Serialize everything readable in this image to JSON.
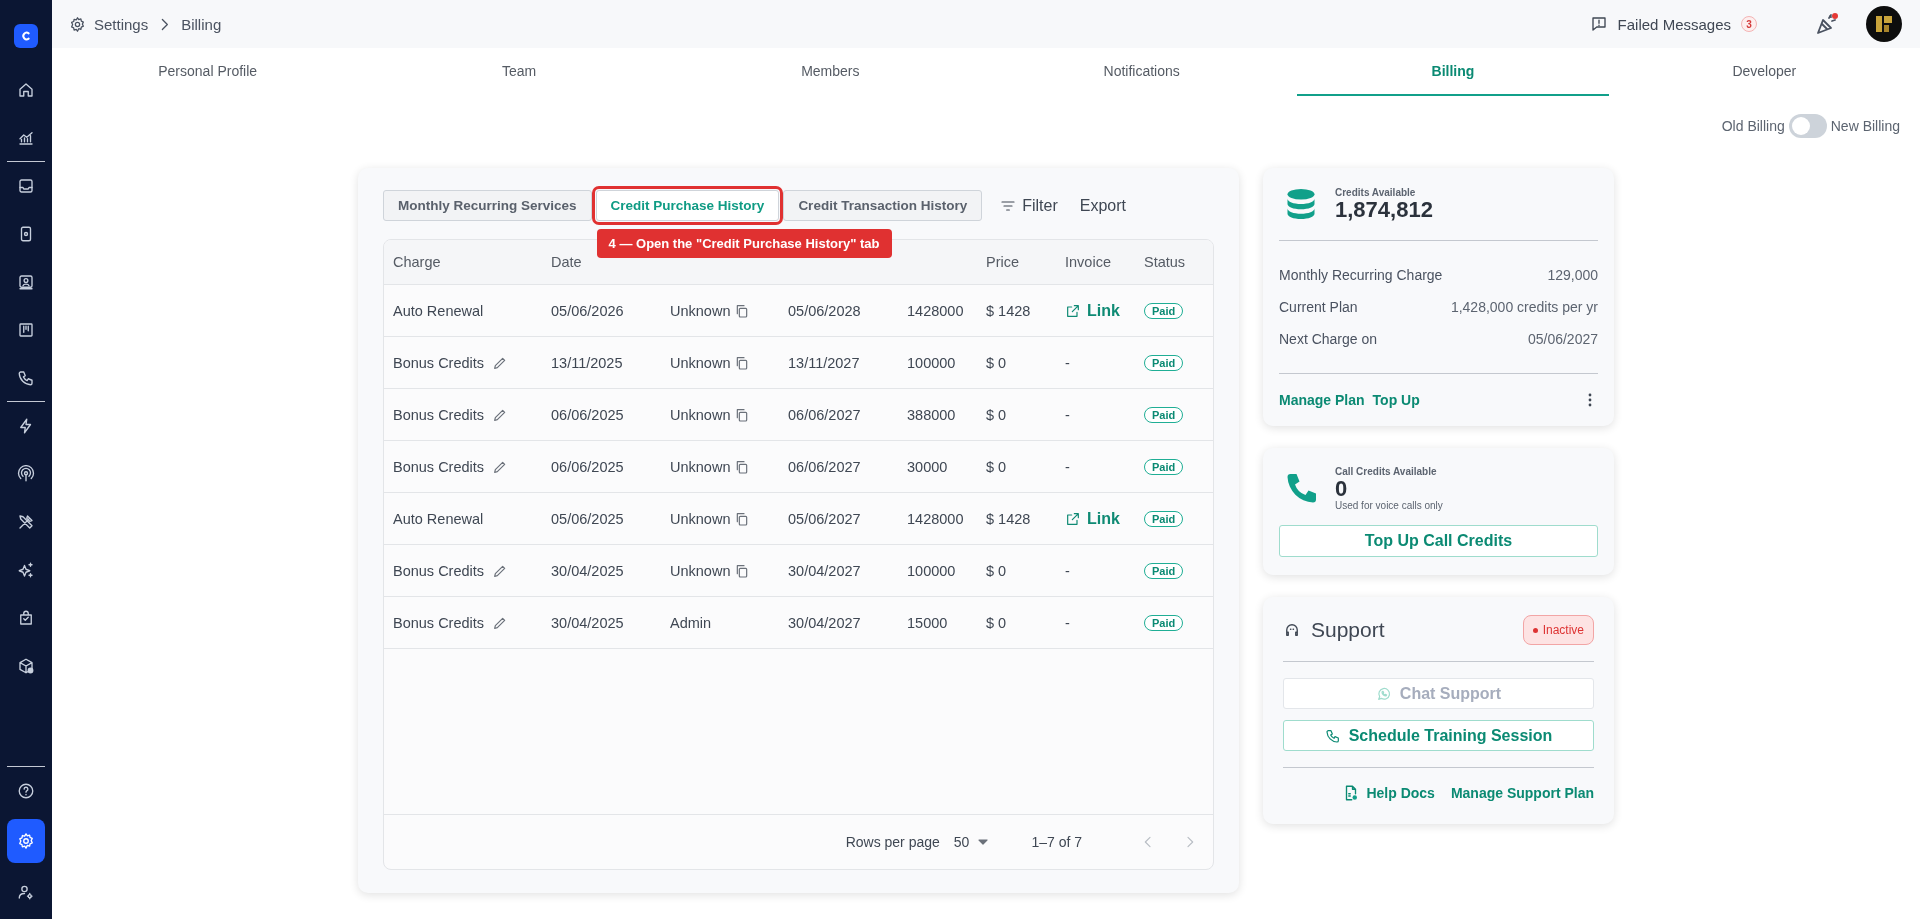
{
  "sidebar": {
    "items": [
      {
        "selected": false
      },
      {
        "selected": false
      },
      {
        "selected": false
      },
      {
        "selected": false
      },
      {
        "selected": false
      },
      {
        "selected": false
      },
      {
        "selected": false
      },
      {
        "selected": false
      },
      {
        "selected": false
      },
      {
        "selected": false
      },
      {
        "selected": false
      },
      {
        "selected": false
      },
      {
        "selected": false
      },
      {
        "selected": false
      },
      {
        "selected": true
      },
      {
        "selected": false
      }
    ]
  },
  "breadcrumb": [
    "Settings",
    "Billing"
  ],
  "topbar": {
    "failed_messages": {
      "label": "Failed Messages",
      "count": "3"
    },
    "notification_dot": true
  },
  "tabs": [
    {
      "label": "Personal Profile",
      "selected": false
    },
    {
      "label": "Team",
      "selected": false
    },
    {
      "label": "Members",
      "selected": false
    },
    {
      "label": "Notifications",
      "selected": false
    },
    {
      "label": "Billing",
      "selected": true
    },
    {
      "label": "Developer",
      "selected": false
    }
  ],
  "billing_toggle": {
    "left_label": "Old Billing",
    "right_label": "New Billing",
    "on": false
  },
  "history_tabs": [
    {
      "label": "Monthly Recurring Services",
      "selected": false
    },
    {
      "label": "Credit Purchase History",
      "selected": true,
      "annotation": "4 — Open the \"Credit Purchase History\" tab"
    },
    {
      "label": "Credit Transaction History",
      "selected": false
    }
  ],
  "toolbar": {
    "filter": "Filter",
    "export": "Export"
  },
  "table": {
    "columns": [
      "Charge",
      "Date",
      null,
      null,
      null,
      "Price",
      "Invoice",
      "Status"
    ],
    "rows": [
      {
        "charge": "Auto Renewal",
        "editable": false,
        "date": "05/06/2026",
        "source": "Unknown",
        "copyable": true,
        "expiry": "05/06/2028",
        "credits": "1428000",
        "price": "$ 1428",
        "invoice": {
          "kind": "link",
          "text": "Link"
        },
        "status": "Paid"
      },
      {
        "charge": "Bonus Credits",
        "editable": true,
        "date": "13/11/2025",
        "source": "Unknown",
        "copyable": true,
        "expiry": "13/11/2027",
        "credits": "100000",
        "price": "$ 0",
        "invoice": {
          "kind": "none",
          "text": "-"
        },
        "status": "Paid"
      },
      {
        "charge": "Bonus Credits",
        "editable": true,
        "date": "06/06/2025",
        "source": "Unknown",
        "copyable": true,
        "expiry": "06/06/2027",
        "credits": "388000",
        "price": "$ 0",
        "invoice": {
          "kind": "none",
          "text": "-"
        },
        "status": "Paid"
      },
      {
        "charge": "Bonus Credits",
        "editable": true,
        "date": "06/06/2025",
        "source": "Unknown",
        "copyable": true,
        "expiry": "06/06/2027",
        "credits": "30000",
        "price": "$ 0",
        "invoice": {
          "kind": "none",
          "text": "-"
        },
        "status": "Paid"
      },
      {
        "charge": "Auto Renewal",
        "editable": false,
        "date": "05/06/2025",
        "source": "Unknown",
        "copyable": true,
        "expiry": "05/06/2027",
        "credits": "1428000",
        "price": "$ 1428",
        "invoice": {
          "kind": "link",
          "text": "Link"
        },
        "status": "Paid"
      },
      {
        "charge": "Bonus Credits",
        "editable": true,
        "date": "30/04/2025",
        "source": "Unknown",
        "copyable": true,
        "expiry": "30/04/2027",
        "credits": "100000",
        "price": "$ 0",
        "invoice": {
          "kind": "none",
          "text": "-"
        },
        "status": "Paid"
      },
      {
        "charge": "Bonus Credits",
        "editable": true,
        "date": "30/04/2025",
        "source": "Admin",
        "copyable": false,
        "expiry": "30/04/2027",
        "credits": "15000",
        "price": "$ 0",
        "invoice": {
          "kind": "none",
          "text": "-"
        },
        "status": "Paid"
      }
    ],
    "pagination": {
      "rows_per_page_label": "Rows per page",
      "rows_per_page": "50",
      "range": "1–7 of 7",
      "prev_disabled": true,
      "next_disabled": true
    }
  },
  "credits_card": {
    "title": "Credits Available",
    "value": "1,874,812",
    "details": [
      {
        "label": "Monthly Recurring Charge",
        "value": "129,000"
      },
      {
        "label": "Current Plan",
        "value": "1,428,000 credits per yr"
      },
      {
        "label": "Next Charge on",
        "value": "05/06/2027"
      }
    ],
    "links": [
      "Manage Plan",
      "Top Up"
    ]
  },
  "call_credits_card": {
    "title": "Call Credits Available",
    "value": "0",
    "note": "Used for voice calls only",
    "button": "Top Up Call Credits"
  },
  "support_card": {
    "title": "Support",
    "status": "Inactive",
    "buttons": [
      {
        "label": "Chat Support",
        "kind": "chat",
        "disabled": true
      },
      {
        "label": "Schedule Training Session",
        "kind": "call",
        "disabled": false
      }
    ],
    "links": [
      {
        "label": "Help Docs",
        "kind": "docs"
      },
      {
        "label": "Manage Support Plan",
        "kind": "plain"
      }
    ]
  }
}
